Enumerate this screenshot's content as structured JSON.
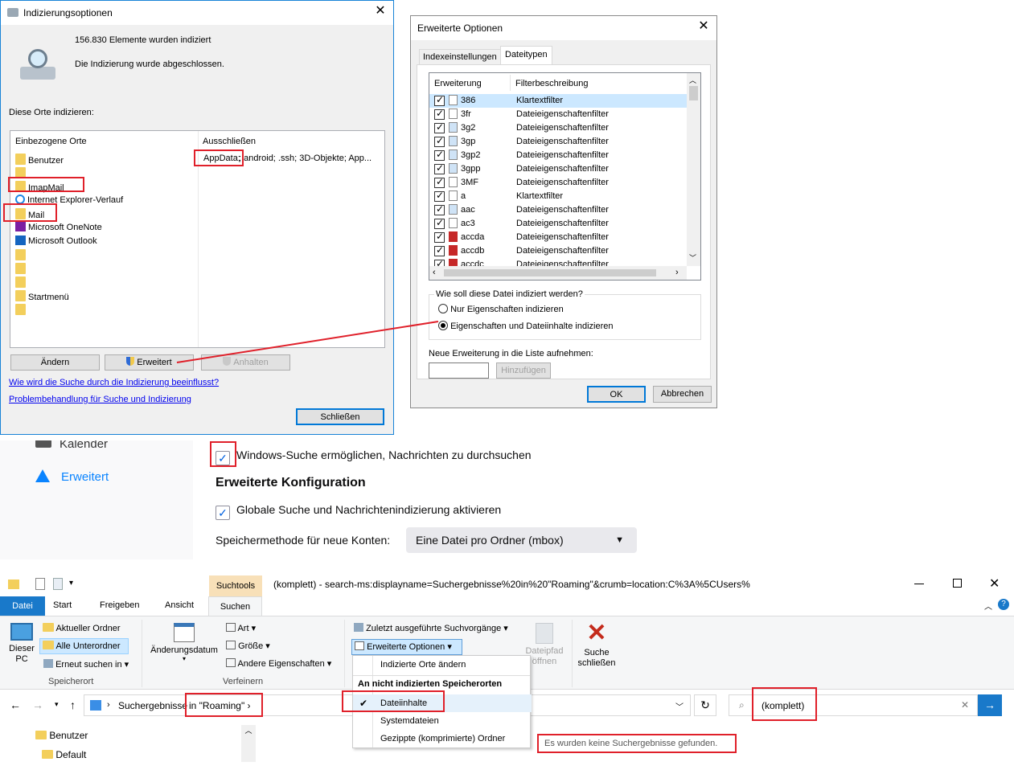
{
  "index_dialog": {
    "title": "Indizierungsoptionen",
    "count_text": "156.830 Elemente wurden indiziert",
    "status_text": "Die Indizierung wurde abgeschlossen.",
    "places_label": "Diese Orte indizieren:",
    "col_included": "Einbezogene Orte",
    "col_excluded": "Ausschließen",
    "places": [
      {
        "label": "Benutzer",
        "icon": "folder-icon"
      },
      {
        "label": "",
        "icon": "folder-icon"
      },
      {
        "label": "ImapMail",
        "icon": "folder-icon"
      },
      {
        "label": "Internet Explorer-Verlauf",
        "icon": "ie-icon"
      },
      {
        "label": "Mail",
        "icon": "folder-icon"
      },
      {
        "label": "Microsoft OneNote",
        "icon": "onenote-icon"
      },
      {
        "label": "Microsoft Outlook",
        "icon": "outlook-icon"
      },
      {
        "label": "",
        "icon": "folder-icon"
      },
      {
        "label": "",
        "icon": "folder-icon"
      },
      {
        "label": "",
        "icon": "folder-icon"
      },
      {
        "label": "Startmenü",
        "icon": "folder-icon"
      },
      {
        "label": "",
        "icon": "folder-icon"
      }
    ],
    "excluded_text": "; android; .ssh; 3D-Objekte; App...",
    "excluded_highlight": "AppData;",
    "btn_change": "Ändern",
    "btn_advanced": "Erweitert",
    "btn_pause": "Anhalten",
    "link_how": "Wie wird die Suche durch die Indizierung beeinflusst?",
    "link_troubleshoot": "Problembehandlung für Suche und Indizierung",
    "btn_close": "Schließen"
  },
  "adv_dialog": {
    "title": "Erweiterte Optionen",
    "tab_settings": "Indexeinstellungen",
    "tab_filetypes": "Dateitypen",
    "col_ext": "Erweiterung",
    "col_filter": "Filterbeschreibung",
    "rows": [
      {
        "ext": "386",
        "filter": "Klartextfilter"
      },
      {
        "ext": "3fr",
        "filter": "Dateieigenschaftenfilter"
      },
      {
        "ext": "3g2",
        "filter": "Dateieigenschaftenfilter"
      },
      {
        "ext": "3gp",
        "filter": "Dateieigenschaftenfilter"
      },
      {
        "ext": "3gp2",
        "filter": "Dateieigenschaftenfilter"
      },
      {
        "ext": "3gpp",
        "filter": "Dateieigenschaftenfilter"
      },
      {
        "ext": "3MF",
        "filter": "Dateieigenschaftenfilter"
      },
      {
        "ext": "a",
        "filter": "Klartextfilter"
      },
      {
        "ext": "aac",
        "filter": "Dateieigenschaftenfilter"
      },
      {
        "ext": "ac3",
        "filter": "Dateieigenschaftenfilter"
      },
      {
        "ext": "accda",
        "filter": "Dateieigenschaftenfilter"
      },
      {
        "ext": "accdb",
        "filter": "Dateieigenschaftenfilter"
      },
      {
        "ext": "accdc",
        "filter": "Dateieigenschaftenfilter"
      }
    ],
    "how_label": "Wie soll diese Datei indiziert werden?",
    "opt_props": "Nur Eigenschaften indizieren",
    "opt_props_content": "Eigenschaften und Dateiinhalte indizieren",
    "new_ext_label": "Neue Erweiterung in die Liste aufnehmen:",
    "btn_add": "Hinzufügen",
    "btn_ok": "OK",
    "btn_cancel": "Abbrechen"
  },
  "tb_settings": {
    "nav_calendar": "Kalender",
    "nav_advanced": "Erweitert",
    "enable_search": "Windows-Suche ermöglichen, Nachrichten zu durchsuchen",
    "section_title": "Erweiterte Konfiguration",
    "global_search": "Globale Suche und Nachrichtenindizierung aktivieren",
    "storage_label": "Speichermethode für neue Konten:",
    "storage_value": "Eine Datei pro Ordner (mbox)"
  },
  "explorer": {
    "context_tab": "Suchtools",
    "title": "(komplett) - search-ms:displayname=Suchergebnisse%20in%20\"Roaming\"&crumb=location:C%3A%5CUsers%",
    "tabs": [
      "Datei",
      "Start",
      "Freigeben",
      "Ansicht",
      "Suchen"
    ],
    "this_pc": "Dieser PC",
    "current_folder": "Aktueller Ordner",
    "all_subfolders": "Alle Unterordner",
    "search_again": "Erneut suchen in",
    "group_location": "Speicherort",
    "date_modified": "Änderungsdatum",
    "kind": "Art",
    "size": "Größe",
    "other_props": "Andere Eigenschaften",
    "group_refine": "Verfeinern",
    "recent_searches": "Zuletzt ausgeführte Suchvorgänge",
    "advanced_options": "Erweiterte Optionen",
    "open_path": "Dateipfad öffnen",
    "close_search": "Suche schließen",
    "breadcrumb_prefix": "Suchergebnisse ",
    "breadcrumb_highlight": "in \"Roaming\"",
    "search_value": "(komplett)",
    "menu_change_locations": "Indizierte Orte ändern",
    "menu_header": "An nicht indizierten Speicherorten",
    "menu_file_contents": "Dateiinhalte",
    "menu_system_files": "Systemdateien",
    "menu_zip": "Gezippte (komprimierte) Ordner",
    "tree_users": "Benutzer",
    "tree_default": "Default",
    "no_results": "Es wurden keine Suchergebnisse gefunden."
  },
  "colors": {
    "accent": "#0078d7",
    "highlight": "#e0202a",
    "ribbon_file": "#1979ca"
  }
}
